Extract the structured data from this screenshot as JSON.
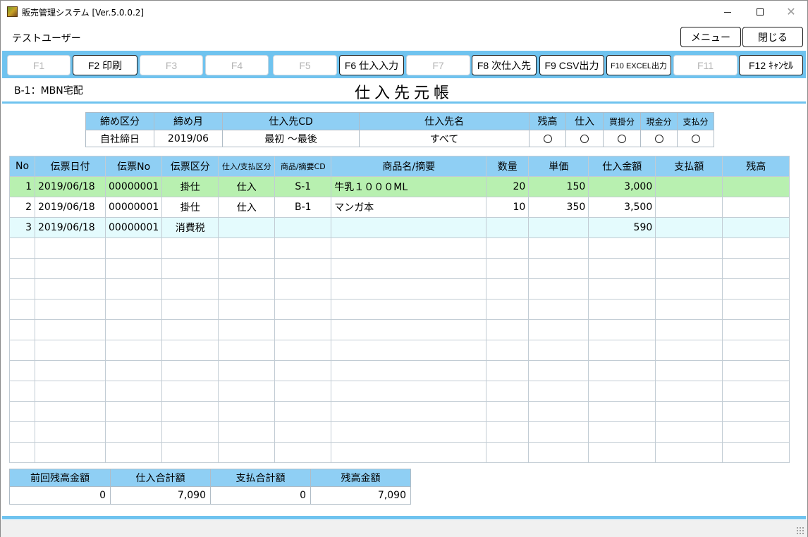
{
  "window": {
    "title": "販売管理システム [Ver.5.0.0.2]",
    "minimize_glyph": "",
    "maximize_glyph": "",
    "close_glyph": "✕"
  },
  "header": {
    "user": "テストユーザー",
    "menu_label": "メニュー",
    "close_label": "閉じる"
  },
  "fkeys": [
    {
      "label": "F1",
      "enabled": false
    },
    {
      "label": "F2 印刷",
      "enabled": true
    },
    {
      "label": "F3",
      "enabled": false
    },
    {
      "label": "F4",
      "enabled": false
    },
    {
      "label": "F5",
      "enabled": false
    },
    {
      "label": "F6 仕入入力",
      "enabled": true
    },
    {
      "label": "F7",
      "enabled": false
    },
    {
      "label": "F8 次仕入先",
      "enabled": true
    },
    {
      "label": "F9 CSV出力",
      "enabled": true
    },
    {
      "label": "F10 EXCEL出力",
      "enabled": true
    },
    {
      "label": "F11",
      "enabled": false
    },
    {
      "label": "F12 ｷｬﾝｾﾙ",
      "enabled": true
    }
  ],
  "company": "B-1：MBN宅配",
  "page_title": "仕入先元帳",
  "filter": {
    "headers": [
      "締め区分",
      "締め月",
      "仕入先CD",
      "仕入先名",
      "残高",
      "仕入",
      "買掛分",
      "現金分",
      "支払分"
    ],
    "values": [
      "自社締日",
      "2019/06",
      "最初 ～最後",
      "すべて"
    ]
  },
  "ledger": {
    "headers": [
      "No",
      "伝票日付",
      "伝票No",
      "伝票区分",
      "仕入/支払区分",
      "商品/摘要CD",
      "商品名/摘要",
      "数量",
      "単価",
      "仕入金額",
      "支払額",
      "残高"
    ],
    "rows": [
      {
        "no": "1",
        "date": "2019/06/18",
        "slip": "00000001",
        "kind": "掛仕",
        "type": "仕入",
        "code": "S-1",
        "name": "牛乳１０００ML",
        "qty": "20",
        "price": "150",
        "amount": "3,000",
        "paid": "",
        "balance": ""
      },
      {
        "no": "2",
        "date": "2019/06/18",
        "slip": "00000001",
        "kind": "掛仕",
        "type": "仕入",
        "code": "B-1",
        "name": "マンガ本",
        "qty": "10",
        "price": "350",
        "amount": "3,500",
        "paid": "",
        "balance": ""
      },
      {
        "no": "3",
        "date": "2019/06/18",
        "slip": "00000001",
        "kind": "消費税",
        "type": "",
        "code": "",
        "name": "",
        "qty": "",
        "price": "",
        "amount": "590",
        "paid": "",
        "balance": ""
      }
    ]
  },
  "summary": {
    "headers": [
      "前回残高金額",
      "仕入合計額",
      "支払合計額",
      "残高金額"
    ],
    "values": [
      "0",
      "7,090",
      "0",
      "7,090"
    ]
  },
  "colors": {
    "accent": "#6fc3ef",
    "header_bg": "#8fcff4",
    "row_selected": "#b8f0b0",
    "row_tax": "#e4fbfd"
  }
}
